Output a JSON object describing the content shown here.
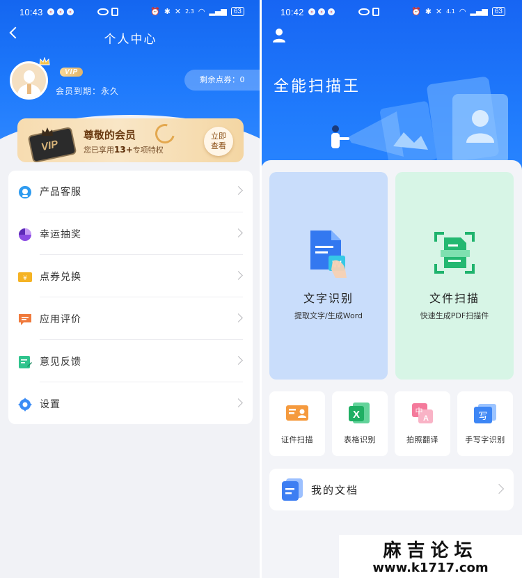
{
  "left": {
    "status": {
      "time": "10:43",
      "battery": "63",
      "net_speed": "2.3"
    },
    "title": "个人中心",
    "profile": {
      "vip_badge": "VIP",
      "member_expire": "会员到期：永久",
      "points": "剩余点券：0"
    },
    "vip_card": {
      "card_text": "VIP",
      "title": "尊敬的会员",
      "sub_prefix": "您已享用",
      "sub_count": "13+",
      "sub_suffix": "专项特权",
      "view_button": "立即查看",
      "view_line1": "立即",
      "view_line2": "查看"
    },
    "menu": [
      {
        "label": "产品客服",
        "icon": "customer-service-icon",
        "color": "#2e9bf0"
      },
      {
        "label": "幸运抽奖",
        "icon": "lucky-draw-icon",
        "color": "#8b4be3"
      },
      {
        "label": "点券兑换",
        "icon": "coupon-icon",
        "color": "#f5b324"
      },
      {
        "label": "应用评价",
        "icon": "comment-icon",
        "color": "#f07a3c"
      },
      {
        "label": "意见反馈",
        "icon": "feedback-icon",
        "color": "#2fc48d"
      },
      {
        "label": "设置",
        "icon": "gear-icon",
        "color": "#3b8cf5"
      }
    ]
  },
  "right": {
    "status": {
      "time": "10:42",
      "battery": "63",
      "net_speed": "4.1"
    },
    "app_title": "全能扫描王",
    "features": [
      {
        "title": "文字识别",
        "subtitle": "提取文字/生成Word"
      },
      {
        "title": "文件扫描",
        "subtitle": "快速生成PDF扫描件"
      }
    ],
    "tools": [
      {
        "label": "证件扫描",
        "icon": "id-card-icon"
      },
      {
        "label": "表格识别",
        "icon": "excel-icon"
      },
      {
        "label": "拍照翻译",
        "icon": "translate-icon"
      },
      {
        "label": "手写字识别",
        "icon": "handwriting-icon"
      }
    ],
    "my_docs": "我的文档"
  },
  "watermark": {
    "title": "麻吉论坛",
    "url": "www.k1717.com"
  }
}
